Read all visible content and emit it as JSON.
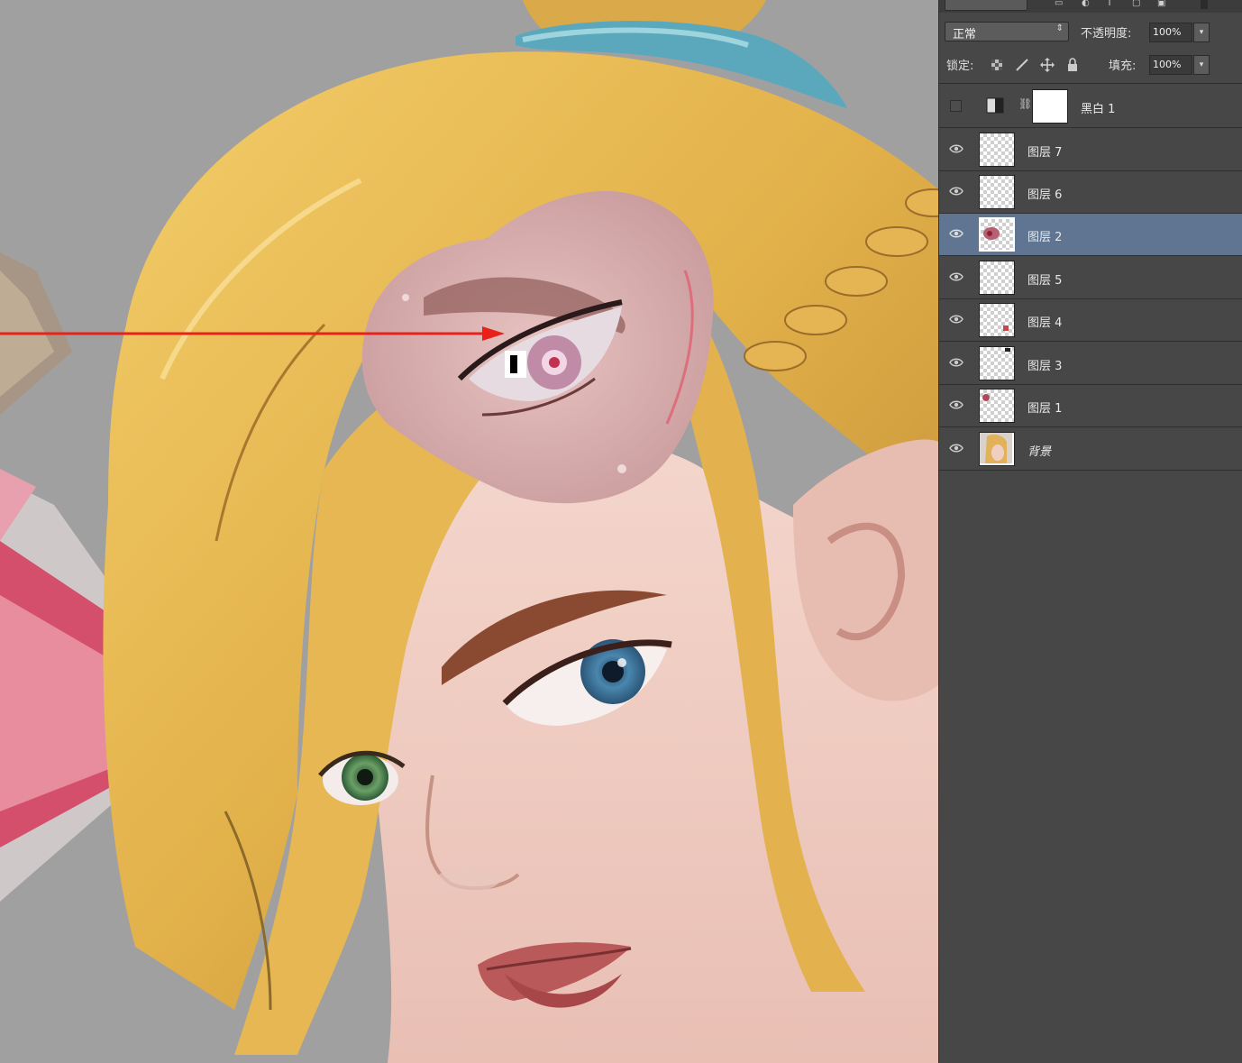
{
  "panel": {
    "blend_mode": "正常",
    "opacity_label": "不透明度:",
    "opacity_value": "100%",
    "lock_label": "锁定:",
    "fill_label": "填充:",
    "fill_value": "100%"
  },
  "layers": [
    {
      "name": "黑白 1",
      "type": "adjustment",
      "visible": false
    },
    {
      "name": "图层 7",
      "type": "pixel",
      "visible": true
    },
    {
      "name": "图层 6",
      "type": "pixel",
      "visible": true
    },
    {
      "name": "图层 2",
      "type": "pixel",
      "visible": true,
      "selected": true
    },
    {
      "name": "图层 5",
      "type": "pixel",
      "visible": true
    },
    {
      "name": "图层 4",
      "type": "pixel",
      "visible": true
    },
    {
      "name": "图层 3",
      "type": "pixel",
      "visible": true
    },
    {
      "name": "图层 1",
      "type": "pixel",
      "visible": true
    },
    {
      "name": "背景",
      "type": "background",
      "visible": true
    }
  ],
  "icons": {
    "visibility": "eye-icon",
    "adjustment": "black-white-adjustment-icon",
    "link": "chain-link-icon",
    "lock_transparent": "lock-transparent-pixels-icon",
    "lock_image": "lock-image-pixels-icon",
    "lock_position": "lock-position-icon",
    "lock_all": "lock-all-icon"
  },
  "colors": {
    "panel_bg": "#474747",
    "selected_layer": "#5f7591",
    "canvas_bg": "#a0a0a0",
    "arrow": "#e8221a"
  }
}
